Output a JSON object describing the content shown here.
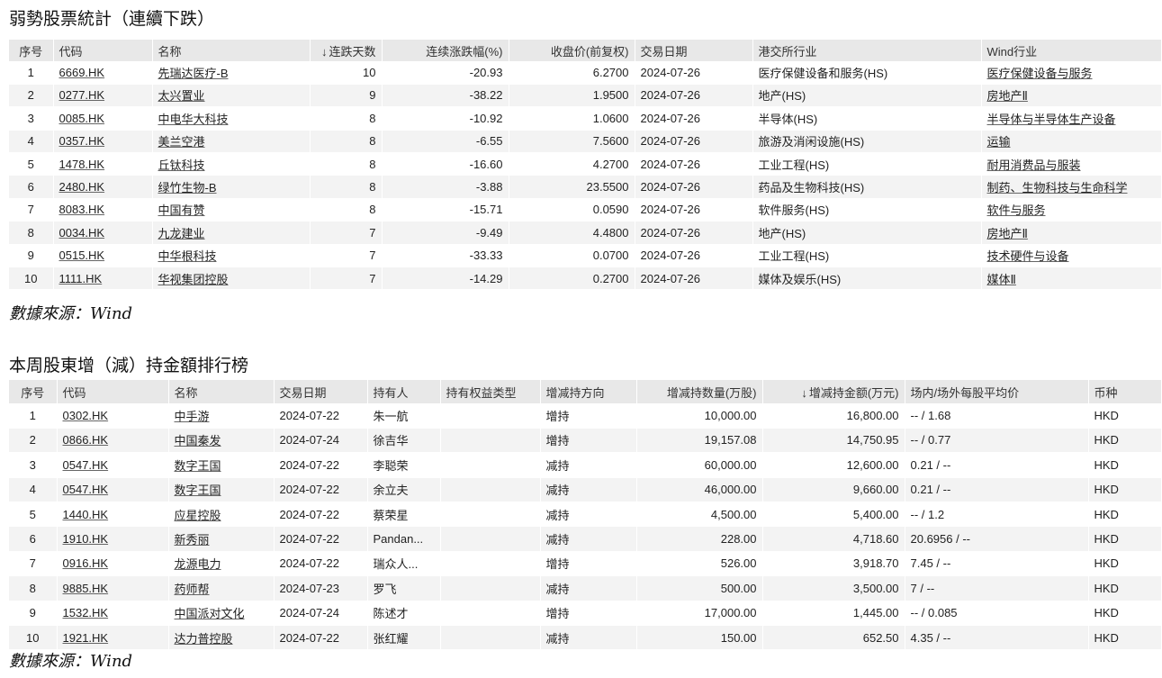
{
  "table1": {
    "title": "弱勢股票統計（連續下跌）",
    "headers": [
      "序号",
      "代码",
      "名称",
      "连跌天数",
      "连续涨跌幅(%)",
      "收盘价(前复权)",
      "交易日期",
      "港交所行业",
      "Wind行业"
    ],
    "sort_arrow": "↓",
    "rows": [
      [
        "1",
        "6669.HK",
        "先瑞达医疗-B",
        "10",
        "-20.93",
        "6.2700",
        "2024-07-26",
        "医疗保健设备和服务(HS)",
        "医疗保健设备与服务"
      ],
      [
        "2",
        "0277.HK",
        "太兴置业",
        "9",
        "-38.22",
        "1.9500",
        "2024-07-26",
        "地产(HS)",
        "房地产Ⅱ"
      ],
      [
        "3",
        "0085.HK",
        "中电华大科技",
        "8",
        "-10.92",
        "1.0600",
        "2024-07-26",
        "半导体(HS)",
        "半导体与半导体生产设备"
      ],
      [
        "4",
        "0357.HK",
        "美兰空港",
        "8",
        "-6.55",
        "7.5600",
        "2024-07-26",
        "旅游及消闲设施(HS)",
        "运输"
      ],
      [
        "5",
        "1478.HK",
        "丘钛科技",
        "8",
        "-16.60",
        "4.2700",
        "2024-07-26",
        "工业工程(HS)",
        "耐用消费品与服装"
      ],
      [
        "6",
        "2480.HK",
        "绿竹生物-B",
        "8",
        "-3.88",
        "23.5500",
        "2024-07-26",
        "药品及生物科技(HS)",
        "制药、生物科技与生命科学"
      ],
      [
        "7",
        "8083.HK",
        "中国有赞",
        "8",
        "-15.71",
        "0.0590",
        "2024-07-26",
        "软件服务(HS)",
        "软件与服务"
      ],
      [
        "8",
        "0034.HK",
        "九龙建业",
        "7",
        "-9.49",
        "4.4800",
        "2024-07-26",
        "地产(HS)",
        "房地产Ⅱ"
      ],
      [
        "9",
        "0515.HK",
        "中华根科技",
        "7",
        "-33.33",
        "0.0700",
        "2024-07-26",
        "工业工程(HS)",
        "技术硬件与设备"
      ],
      [
        "10",
        "1111.HK",
        "华视集团控股",
        "7",
        "-14.29",
        "0.2700",
        "2024-07-26",
        "媒体及娱乐(HS)",
        "媒体Ⅱ"
      ]
    ],
    "source": "數據來源：Wind"
  },
  "table2": {
    "title": "本周股東增（減）持金額排行榜",
    "headers": [
      "序号",
      "代码",
      "名称",
      "交易日期",
      "持有人",
      "持有权益类型",
      "增减持方向",
      "增减持数量(万股)",
      "增减持金额(万元)",
      "场内/场外每股平均价",
      "币种"
    ],
    "sort_arrow": "↓",
    "rows": [
      [
        "1",
        "0302.HK",
        "中手游",
        "2024-07-22",
        "朱一航",
        "",
        "增持",
        "10,000.00",
        "16,800.00",
        "-- / 1.68",
        "HKD"
      ],
      [
        "2",
        "0866.HK",
        "中国秦发",
        "2024-07-24",
        "徐吉华",
        "",
        "增持",
        "19,157.08",
        "14,750.95",
        "-- / 0.77",
        "HKD"
      ],
      [
        "3",
        "0547.HK",
        "数字王国",
        "2024-07-22",
        "李聪荣",
        "",
        "减持",
        "60,000.00",
        "12,600.00",
        "0.21 / --",
        "HKD"
      ],
      [
        "4",
        "0547.HK",
        "数字王国",
        "2024-07-22",
        "余立夫",
        "",
        "减持",
        "46,000.00",
        "9,660.00",
        "0.21 / --",
        "HKD"
      ],
      [
        "5",
        "1440.HK",
        "应星控股",
        "2024-07-22",
        "蔡荣星",
        "",
        "减持",
        "4,500.00",
        "5,400.00",
        "-- / 1.2",
        "HKD"
      ],
      [
        "6",
        "1910.HK",
        "新秀丽",
        "2024-07-22",
        "Pandan...",
        "",
        "减持",
        "228.00",
        "4,718.60",
        "20.6956 / --",
        "HKD"
      ],
      [
        "7",
        "0916.HK",
        "龙源电力",
        "2024-07-22",
        "瑞众人...",
        "",
        "增持",
        "526.00",
        "3,918.70",
        "7.45 / --",
        "HKD"
      ],
      [
        "8",
        "9885.HK",
        "药师帮",
        "2024-07-23",
        "罗飞",
        "",
        "减持",
        "500.00",
        "3,500.00",
        "7 / --",
        "HKD"
      ],
      [
        "9",
        "1532.HK",
        "中国派对文化",
        "2024-07-24",
        "陈述才",
        "",
        "增持",
        "17,000.00",
        "1,445.00",
        "-- / 0.085",
        "HKD"
      ],
      [
        "10",
        "1921.HK",
        "达力普控股",
        "2024-07-22",
        "张红耀",
        "",
        "减持",
        "150.00",
        "652.50",
        "4.35 / --",
        "HKD"
      ]
    ],
    "source": "數據來源：Wind"
  }
}
